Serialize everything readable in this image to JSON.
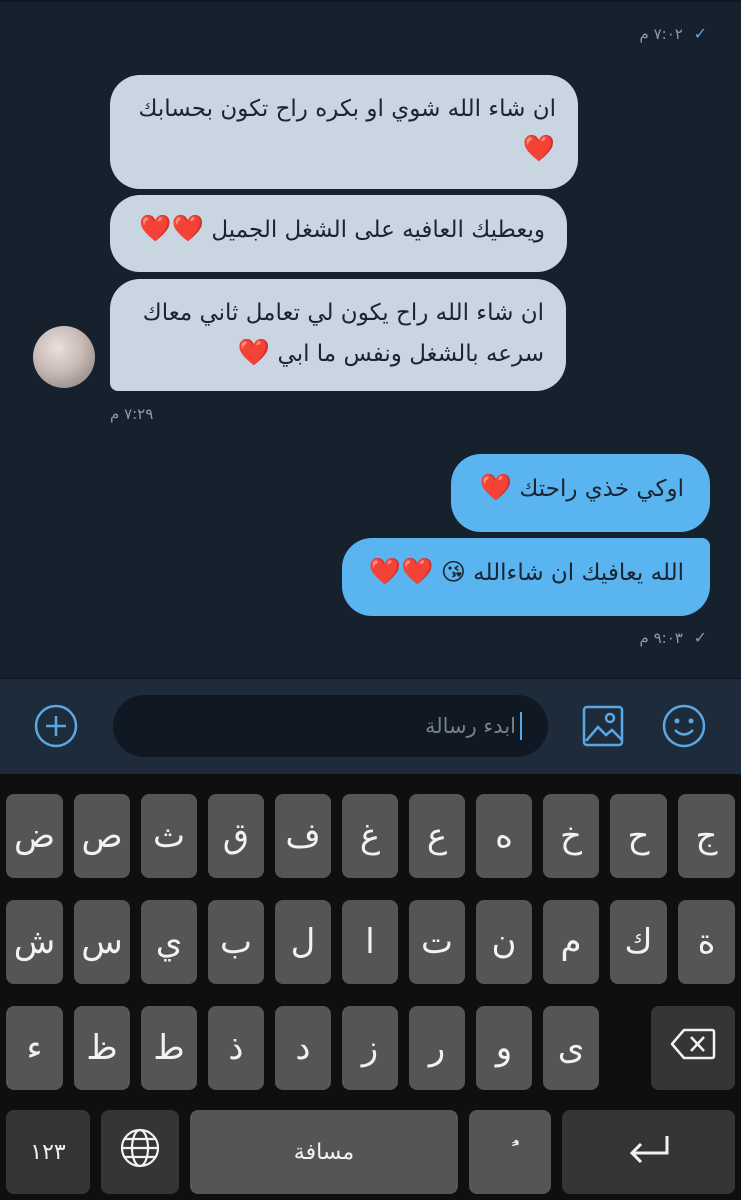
{
  "chat": {
    "top_status": {
      "time": "٧:٠٢ م",
      "check": "✓"
    },
    "incoming": [
      {
        "text": "ان شاء الله شوي او بكره راح تكون بحسابك",
        "hearts": "❤️"
      },
      {
        "text": "ويعطيك العافيه على الشغل الجميل",
        "hearts": "❤️❤️"
      },
      {
        "text_line1": "ان شاء الله راح يكون لي تعامل ثاني معاك",
        "text_line2": "سرعه بالشغل ونفس ما ابي",
        "hearts": "❤️"
      }
    ],
    "incoming_time": "٧:٢٩ م",
    "outgoing": [
      {
        "text": "اوكي خذي راحتك",
        "hearts": "❤️"
      },
      {
        "text": "الله يعافيك ان شاءالله",
        "emoji": "😘",
        "hearts": "❤️❤️"
      }
    ],
    "outgoing_status": {
      "time": "٩:٠٣ م",
      "check": "✓"
    }
  },
  "composer": {
    "placeholder": "ابدء رسالة",
    "icons": [
      "add-icon",
      "image-icon",
      "emoji-icon"
    ]
  },
  "keyboard": {
    "row1": [
      "ض",
      "ص",
      "ث",
      "ق",
      "ف",
      "غ",
      "ع",
      "ه",
      "خ",
      "ح",
      "ج"
    ],
    "row2": [
      "ش",
      "س",
      "ي",
      "ب",
      "ل",
      "ا",
      "ت",
      "ن",
      "م",
      "ك",
      "ة"
    ],
    "row3": [
      "ء",
      "ظ",
      "ط",
      "ذ",
      "د",
      "ز",
      "ر",
      "و",
      "ى"
    ],
    "numbers_label": "١٢٣",
    "space_label": "مسافة",
    "diacritic_label": "ًُ",
    "icons": [
      "backspace-icon",
      "globe-icon",
      "return-icon"
    ]
  },
  "colors": {
    "chat_bg": "#17212d",
    "incoming_bubble": "#c9d5e1",
    "outgoing_bubble": "#5ab4f0",
    "accent": "#5aa7e6",
    "heart": "#e3142d"
  }
}
